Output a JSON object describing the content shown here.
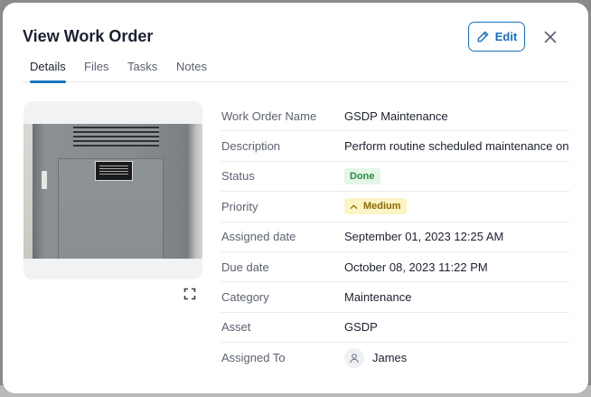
{
  "modal": {
    "title": "View Work Order",
    "edit_label": "Edit",
    "close_icon": "close-icon",
    "edit_icon": "pencil-icon"
  },
  "tabs": [
    {
      "label": "Details",
      "active": true
    },
    {
      "label": "Files",
      "active": false
    },
    {
      "label": "Tasks",
      "active": false
    },
    {
      "label": "Notes",
      "active": false
    }
  ],
  "image": {
    "alt": "",
    "expand_icon": "expand-icon"
  },
  "details": {
    "work_order_name": {
      "label": "Work Order Name",
      "value": "GSDP Maintenance"
    },
    "description": {
      "label": "Description",
      "value": "Perform routine scheduled maintenance on GSDP"
    },
    "status": {
      "label": "Status",
      "value": "Done",
      "color": "#2e8b47"
    },
    "priority": {
      "label": "Priority",
      "value": "Medium",
      "icon": "chevron-up-icon",
      "color": "#8a6a00"
    },
    "assigned_date": {
      "label": "Assigned date",
      "value": "September 01, 2023 12:25 AM"
    },
    "due_date": {
      "label": "Due date",
      "value": "October 08, 2023 11:22 PM"
    },
    "category": {
      "label": "Category",
      "value": "Maintenance"
    },
    "asset": {
      "label": "Asset",
      "value": "GSDP"
    },
    "assigned_to": {
      "label": "Assigned To",
      "value": "James",
      "icon": "user-icon"
    }
  },
  "colors": {
    "accent": "#1b74c4",
    "overlay": "#8a8a8a"
  }
}
